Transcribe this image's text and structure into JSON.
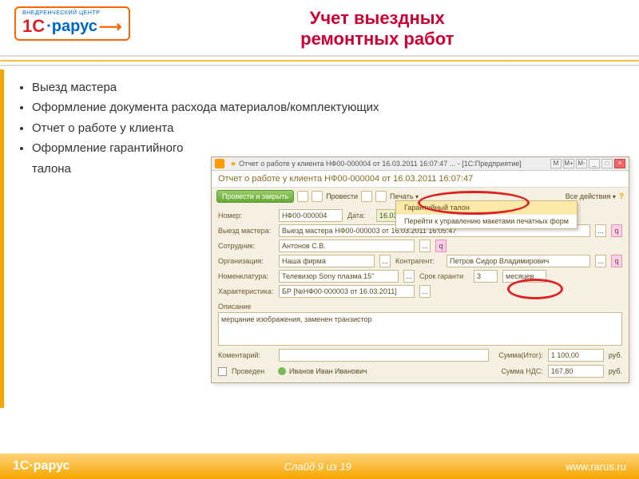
{
  "logo": {
    "top": "ВНЕДРЕНЧЕСКИЙ ЦЕНТР",
    "c1": "1С",
    "rarus": "рарус"
  },
  "title_l1": "Учет выездных",
  "title_l2": "ремонтных работ",
  "bullets": [
    "Выезд мастера",
    "Оформление документа расхода материалов/комплектующих",
    "Отчет о работе  у клиента",
    "Оформление гарантийного талона"
  ],
  "win": {
    "titlebar": "Отчет о работе у клиента НФ00-000004 от 16.03.2011 16:07:47 ... - [1С:Предприятие]",
    "doc_title": "Отчет о работе у клиента НФ00-000004 от 16.03.2011 16:07:47",
    "toolbar": {
      "submit": "Провести и закрыть",
      "conduct": "Провести",
      "print": "Печать",
      "all_actions": "Все действия"
    },
    "dropdown": {
      "i1": "Гарантийный талон",
      "i2": "Перейти к управлению макетами печатных форм"
    },
    "labels": {
      "num": "Номер:",
      "date": "Дата:",
      "trip": "Выезд мастера:",
      "emp": "Сотрудник:",
      "org": "Организация:",
      "cont": "Контрагент:",
      "nom": "Номенклатура:",
      "warr": "Срок гаранти",
      "char": "Характеристика:",
      "desc": "Описание",
      "comm": "Коментарий:",
      "held": "Проведен",
      "sum": "Сумма(Итог):",
      "vat": "Сумма НДС:"
    },
    "vals": {
      "num": "НФ00-000004",
      "date": "16.03.2011 16:04",
      "trip": "Выезд мастера НФ00-000003 от 16.03.2011 16:05:47",
      "emp": "Антонов С.В.",
      "org": "Наша фирма",
      "cont": "Петров Сидор Владимирович",
      "nom": "Телевизор Sony плазма 15''",
      "warr_n": "3",
      "warr_u": "месяцев",
      "char": "БР [№НФ00-000003 от 16.03.2011]",
      "desc": "мерцание изображения, заменен транзистор",
      "user": "Иванов Иван Иванович",
      "sum": "1 100,00",
      "vat": "167,80",
      "rub": "руб."
    }
  },
  "footer": {
    "logo": "1С·рарус",
    "slide": "Слайд 9 из  19",
    "url": "www.rarus.ru"
  }
}
